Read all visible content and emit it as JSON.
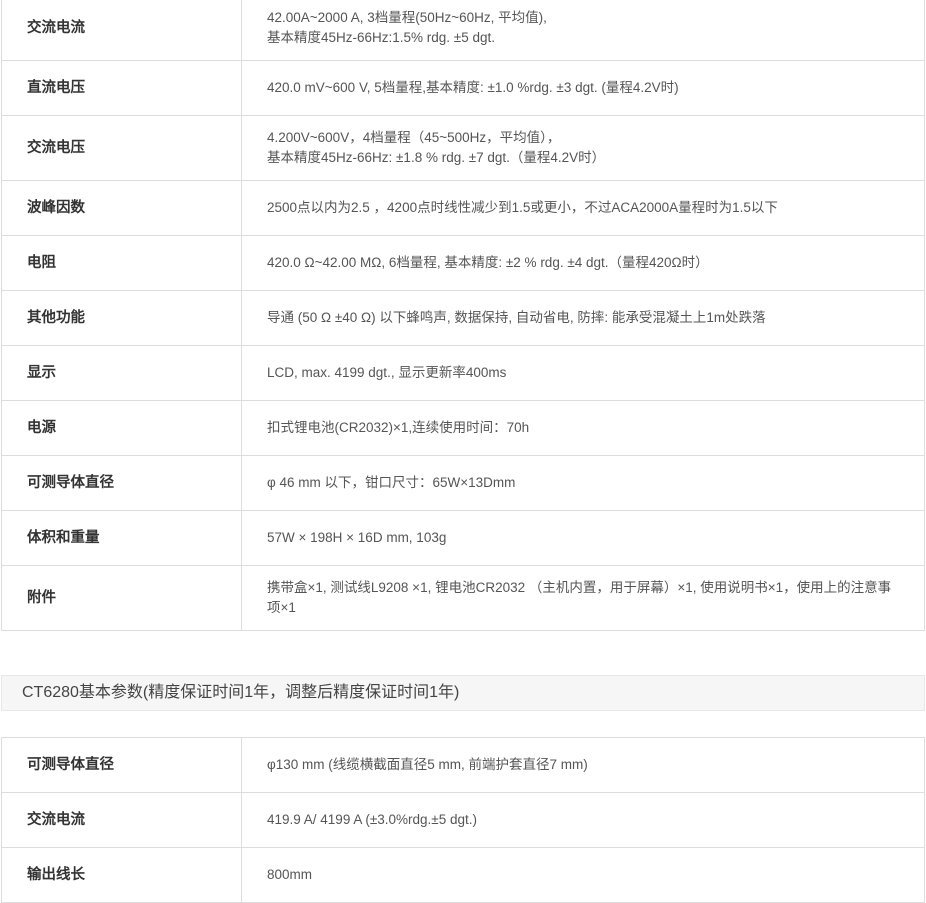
{
  "table1": {
    "rows": [
      {
        "label": "交流电流",
        "lines": [
          "42.00A~2000 A, 3档量程(50Hz~60Hz, 平均值),",
          "基本精度45Hz-66Hz:1.5% rdg. ±5 dgt."
        ]
      },
      {
        "label": "直流电压",
        "lines": [
          "420.0 mV~600 V, 5档量程,基本精度: ±1.0 %rdg. ±3 dgt. (量程4.2V时)"
        ]
      },
      {
        "label": "交流电压",
        "lines": [
          "4.200V~600V，4档量程（45~500Hz，平均值），",
          "基本精度45Hz-66Hz: ±1.8 % rdg. ±7 dgt.（量程4.2V时）"
        ]
      },
      {
        "label": "波峰因数",
        "lines": [
          "2500点以内为2.5 ，4200点时线性减少到1.5或更小，不过ACA2000A量程时为1.5以下"
        ]
      },
      {
        "label": "电阻",
        "lines": [
          "420.0 Ω~42.00 MΩ, 6档量程, 基本精度: ±2 % rdg. ±4 dgt.（量程420Ω时）"
        ]
      },
      {
        "label": "其他功能",
        "lines": [
          "导通 (50 Ω ±40 Ω) 以下蜂鸣声, 数据保持, 自动省电, 防摔: 能承受混凝土上1m处跌落"
        ]
      },
      {
        "label": "显示",
        "lines": [
          "LCD, max. 4199 dgt., 显示更新率400ms"
        ]
      },
      {
        "label": "电源",
        "lines": [
          "扣式锂电池(CR2032)×1,连续使用时间：70h"
        ]
      },
      {
        "label": "可测导体直径",
        "lines": [
          "φ 46 mm 以下，钳口尺寸：65W×13Dmm"
        ]
      },
      {
        "label": "体积和重量",
        "lines": [
          "57W × 198H × 16D mm, 103g"
        ]
      },
      {
        "label": "附件",
        "lines": [
          "携带盒×1, 测试线L9208 ×1, 锂电池CR2032 （主机内置，用于屏幕）×1, 使用说明书×1，使用上的注意事",
          "项×1"
        ]
      }
    ]
  },
  "section2": {
    "heading": "CT6280基本参数(精度保证时间1年，调整后精度保证时间1年)"
  },
  "table2": {
    "rows": [
      {
        "label": "可测导体直径",
        "lines": [
          "φ130 mm (线缆横截面直径5 mm, 前端护套直径7 mm)"
        ]
      },
      {
        "label": "交流电流",
        "lines": [
          "419.9 A/ 4199 A (±3.0%rdg.±5 dgt.)"
        ]
      },
      {
        "label": "输出线长",
        "lines": [
          "800mm"
        ]
      }
    ]
  }
}
